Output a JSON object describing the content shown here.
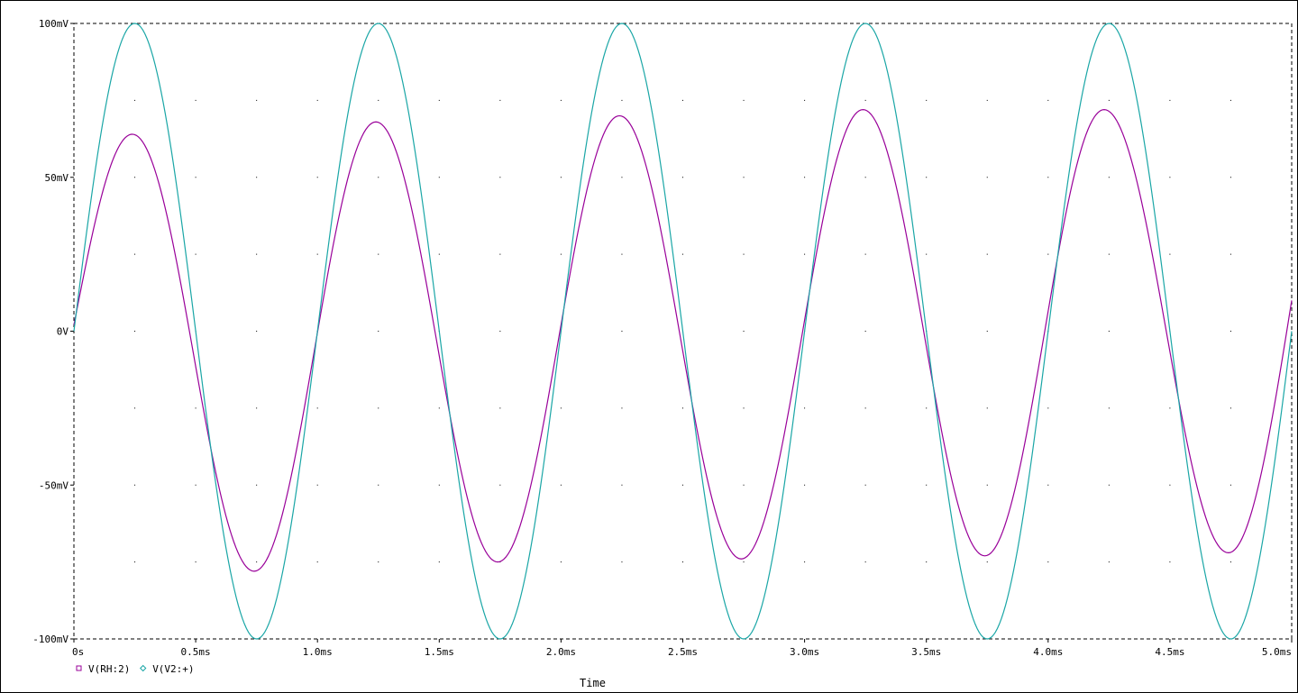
{
  "chart_data": {
    "type": "line",
    "title": "",
    "xlabel": "Time",
    "ylabel": "",
    "x_unit": "ms",
    "y_unit": "mV",
    "xlim": [
      0,
      5.0
    ],
    "ylim": [
      -100,
      100
    ],
    "grid": "dotted",
    "legend_position": "bottom-left",
    "x_ticks": [
      {
        "value": 0,
        "label": "0s"
      },
      {
        "value": 0.5,
        "label": "0.5ms"
      },
      {
        "value": 1.0,
        "label": "1.0ms"
      },
      {
        "value": 1.5,
        "label": "1.5ms"
      },
      {
        "value": 2.0,
        "label": "2.0ms"
      },
      {
        "value": 2.5,
        "label": "2.5ms"
      },
      {
        "value": 3.0,
        "label": "3.0ms"
      },
      {
        "value": 3.5,
        "label": "3.5ms"
      },
      {
        "value": 4.0,
        "label": "4.0ms"
      },
      {
        "value": 4.5,
        "label": "4.5ms"
      },
      {
        "value": 5.0,
        "label": "5.0ms"
      }
    ],
    "y_ticks": [
      {
        "value": 100,
        "label": "100mV"
      },
      {
        "value": 50,
        "label": "50mV"
      },
      {
        "value": 0,
        "label": "0V"
      },
      {
        "value": -50,
        "label": "-50mV"
      },
      {
        "value": -100,
        "label": "-100mV"
      }
    ],
    "series": [
      {
        "name": "V(RH:2)",
        "color": "#990099",
        "marker": "square",
        "x": [
          0,
          0.24,
          0.74,
          1.24,
          1.74,
          2.24,
          2.74,
          3.24,
          3.74,
          4.23,
          4.74,
          5.0
        ],
        "values": [
          2,
          64,
          -78,
          68,
          -75,
          70,
          -74,
          72,
          -73,
          72,
          -72,
          10
        ]
      },
      {
        "name": "V(V2:+)",
        "color": "#1aa6a6",
        "marker": "diamond",
        "x": [
          0,
          0.25,
          0.75,
          1.25,
          1.75,
          2.25,
          2.75,
          3.25,
          3.75,
          4.25,
          4.75,
          5.0
        ],
        "values": [
          0,
          100,
          -100,
          100,
          -100,
          100,
          -100,
          100,
          -100,
          100,
          -100,
          0
        ]
      }
    ]
  }
}
